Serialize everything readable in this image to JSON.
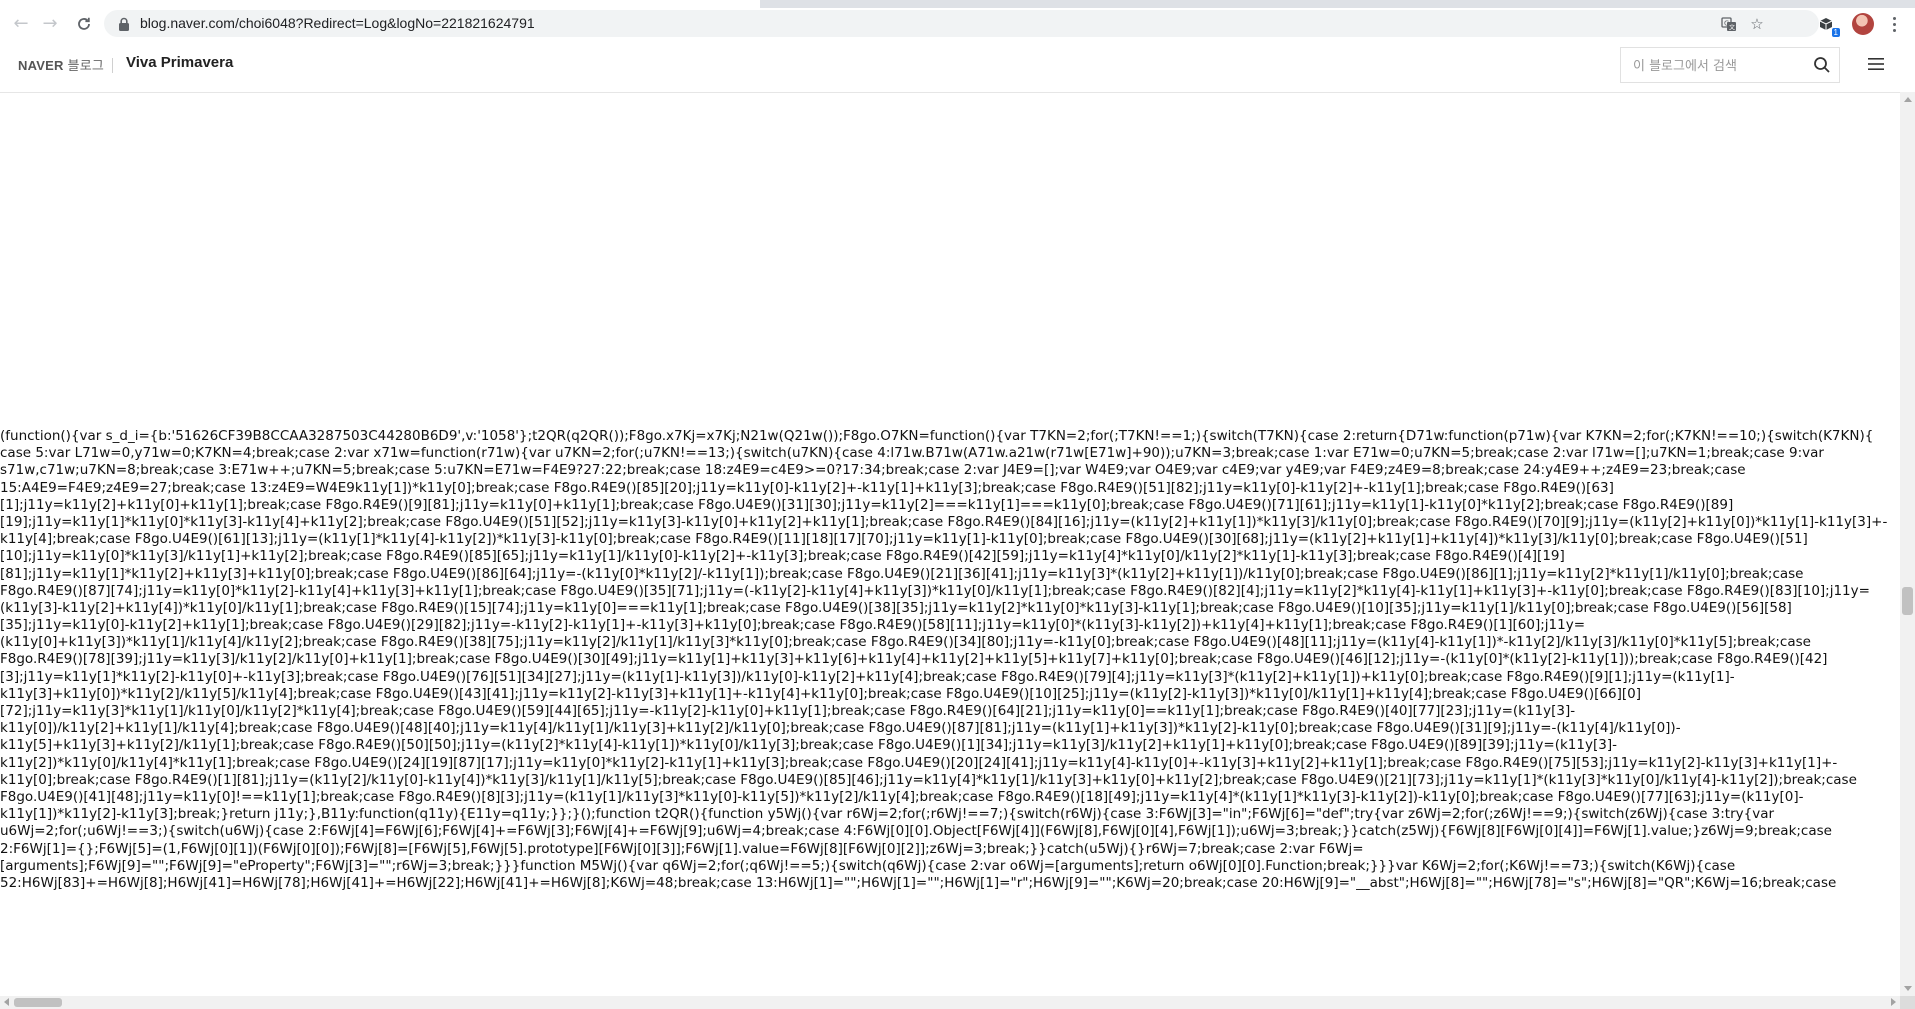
{
  "browser": {
    "url": "blog.naver.com/choi6048?Redirect=Log&logNo=221821624791",
    "extension_badge": "1",
    "icons": {
      "back": "back-arrow-icon",
      "forward": "forward-arrow-icon",
      "reload": "reload-icon",
      "lock": "lock-icon",
      "translate": "translate-icon",
      "bookmark": "star-icon",
      "extension": "extension-icon",
      "menu": "more-vert-icon"
    }
  },
  "header": {
    "naver": "NAVER",
    "blog_word": "블로그",
    "blog_title": "Viva Primavera",
    "search_placeholder": "이 블로그에서 검색",
    "search_icon": "search-icon",
    "menu_icon": "hamburger-menu-icon"
  },
  "content": {
    "code_lines": [
      "(function(){var s_d_i={b:'51626CF39B8CCAA3287503C44280B6D9',v:'1058'};t2QR(q2QR());F8go.x7Kj=x7Kj;N21w(Q21w());F8go.O7KN=function(){var T7KN=2;for(;T7KN!==1;){switch(T7KN){case 2:return{D71w:function(p71w){var K7KN=2;for(;K7KN!==10;){switch(K7KN){",
      "case 5:var L71w=0,y71w=0;K7KN=4;break;case 2:var x71w=function(r71w){var u7KN=2;for(;u7KN!==13;){switch(u7KN){case 4:l71w.B71w(A71w.a21w(r71w[E71w]+90));u7KN=3;break;case 1:var E71w=0;u7KN=5;break;case 2:var l71w=[];u7KN=1;break;case 9:var",
      "s71w,c71w;u7KN=8;break;case 3:E71w++;u7KN=5;break;case 5:u7KN=E71w=F4E9?27:22;break;case 18:z4E9=c4E9>=0?17:34;break;case 2:var J4E9=[];var W4E9;var O4E9;var c4E9;var y4E9;var F4E9;z4E9=8;break;case 24:y4E9++;z4E9=23;break;case",
      "15:A4E9=F4E9;z4E9=27;break;case 13:z4E9=W4E9k11y[1])*k11y[0];break;case F8go.R4E9()[85][20];j11y=k11y[0]-k11y[2]+-k11y[1]+k11y[3];break;case F8go.R4E9()[51][82];j11y=k11y[0]-k11y[2]+-k11y[1];break;case F8go.R4E9()[63]",
      "[1];j11y=k11y[2]+k11y[0]+k11y[1];break;case F8go.R4E9()[9][81];j11y=k11y[0]+k11y[1];break;case F8go.U4E9()[31][30];j11y=k11y[2]===k11y[1]===k11y[0];break;case F8go.U4E9()[71][61];j11y=k11y[1]-k11y[0]*k11y[2];break;case F8go.R4E9()[89]",
      "[19];j11y=k11y[1]*k11y[0]*k11y[3]-k11y[4]+k11y[2];break;case F8go.U4E9()[51][52];j11y=k11y[3]-k11y[0]+k11y[2]+k11y[1];break;case F8go.R4E9()[84][16];j11y=(k11y[2]+k11y[1])*k11y[3]/k11y[0];break;case F8go.R4E9()[70][9];j11y=(k11y[2]+k11y[0])*k11y[1]-k11y[3]+-",
      "k11y[4];break;case F8go.U4E9()[61][13];j11y=(k11y[1]*k11y[4]-k11y[2])*k11y[3]-k11y[0];break;case F8go.R4E9()[11][18][17][70];j11y=k11y[1]-k11y[0];break;case F8go.U4E9()[30][68];j11y=(k11y[2]+k11y[1]+k11y[4])*k11y[3]/k11y[0];break;case F8go.U4E9()[51]",
      "[10];j11y=k11y[0]*k11y[3]/k11y[1]+k11y[2];break;case F8go.R4E9()[85][65];j11y=k11y[1]/k11y[0]-k11y[2]+-k11y[3];break;case F8go.R4E9()[42][59];j11y=k11y[4]*k11y[0]/k11y[2]*k11y[1]-k11y[3];break;case F8go.R4E9()[4][19]",
      "[81];j11y=k11y[1]*k11y[2]+k11y[3]+k11y[0];break;case F8go.U4E9()[86][64];j11y=-(k11y[0]*k11y[2]/-k11y[1]);break;case F8go.U4E9()[21][36][41];j11y=k11y[3]*(k11y[2]+k11y[1])/k11y[0];break;case F8go.U4E9()[86][1];j11y=k11y[2]*k11y[1]/k11y[0];break;case",
      "F8go.R4E9()[87][74];j11y=k11y[0]*k11y[2]-k11y[4]+k11y[3]+k11y[1];break;case F8go.U4E9()[35][71];j11y=(-k11y[2]-k11y[4]+k11y[3])*k11y[0]/k11y[1];break;case F8go.R4E9()[82][4];j11y=k11y[2]*k11y[4]-k11y[1]+k11y[3]+-k11y[0];break;case F8go.R4E9()[83][10];j11y=",
      "(k11y[3]-k11y[2]+k11y[4])*k11y[0]/k11y[1];break;case F8go.R4E9()[15][74];j11y=k11y[0]===k11y[1];break;case F8go.U4E9()[38][35];j11y=k11y[2]*k11y[0]*k11y[3]-k11y[1];break;case F8go.U4E9()[10][35];j11y=k11y[1]/k11y[0];break;case F8go.U4E9()[56][58]",
      "[35];j11y=k11y[0]-k11y[2]+k11y[1];break;case F8go.U4E9()[29][82];j11y=-k11y[2]-k11y[1]+-k11y[3]+k11y[0];break;case F8go.R4E9()[58][11];j11y=k11y[0]*(k11y[3]-k11y[2])+k11y[4]+k11y[1];break;case F8go.R4E9()[1][60];j11y=",
      "(k11y[0]+k11y[3])*k11y[1]/k11y[4]/k11y[2];break;case F8go.R4E9()[38][75];j11y=k11y[2]/k11y[1]/k11y[3]*k11y[0];break;case F8go.R4E9()[34][80];j11y=-k11y[0];break;case F8go.U4E9()[48][11];j11y=(k11y[4]-k11y[1])*-k11y[2]/k11y[3]/k11y[0]*k11y[5];break;case",
      "F8go.R4E9()[78][39];j11y=k11y[3]/k11y[2]/k11y[0]+k11y[1];break;case F8go.U4E9()[30][49];j11y=k11y[1]+k11y[3]+k11y[6]+k11y[4]+k11y[2]+k11y[5]+k11y[7]+k11y[0];break;case F8go.U4E9()[46][12];j11y=-(k11y[0]*(k11y[2]-k11y[1]));break;case F8go.R4E9()[42]",
      "[3];j11y=k11y[1]*k11y[2]-k11y[0]+-k11y[3];break;case F8go.U4E9()[76][51][34][27];j11y=(k11y[1]-k11y[3])/k11y[0]-k11y[2]+k11y[4];break;case F8go.R4E9()[79][4];j11y=k11y[3]*(k11y[2]+k11y[1])+k11y[0];break;case F8go.R4E9()[9][1];j11y=(k11y[1]-",
      "k11y[3]+k11y[0])*k11y[2]/k11y[5]/k11y[4];break;case F8go.U4E9()[43][41];j11y=k11y[2]-k11y[3]+k11y[1]+-k11y[4]+k11y[0];break;case F8go.U4E9()[10][25];j11y=(k11y[2]-k11y[3])*k11y[0]/k11y[1]+k11y[4];break;case F8go.U4E9()[66][0]",
      "[72];j11y=k11y[3]*k11y[1]/k11y[0]/k11y[2]*k11y[4];break;case F8go.U4E9()[59][44][65];j11y=-k11y[2]-k11y[0]+k11y[1];break;case F8go.R4E9()[64][21];j11y=k11y[0]==k11y[1];break;case F8go.R4E9()[40][77][23];j11y=(k11y[3]-",
      "k11y[0])/k11y[2]+k11y[1]/k11y[4];break;case F8go.U4E9()[48][40];j11y=k11y[4]/k11y[1]/k11y[3]+k11y[2]/k11y[0];break;case F8go.U4E9()[87][81];j11y=(k11y[1]+k11y[3])*k11y[2]-k11y[0];break;case F8go.U4E9()[31][9];j11y=-(k11y[4]/k11y[0])-",
      "k11y[5]+k11y[3]+k11y[2]/k11y[1];break;case F8go.R4E9()[50][50];j11y=(k11y[2]*k11y[4]-k11y[1])*k11y[0]/k11y[3];break;case F8go.U4E9()[1][34];j11y=k11y[3]/k11y[2]+k11y[1]+k11y[0];break;case F8go.U4E9()[89][39];j11y=(k11y[3]-",
      "k11y[2])*k11y[0]/k11y[4]*k11y[1];break;case F8go.U4E9()[24][19][87][17];j11y=k11y[0]*k11y[2]-k11y[1]+k11y[3];break;case F8go.U4E9()[20][24][41];j11y=k11y[4]-k11y[0]+-k11y[3]+k11y[2]+k11y[1];break;case F8go.R4E9()[75][53];j11y=k11y[2]-k11y[3]+k11y[1]+-",
      "k11y[0];break;case F8go.R4E9()[1][81];j11y=(k11y[2]/k11y[0]-k11y[4])*k11y[3]/k11y[1]/k11y[5];break;case F8go.U4E9()[85][46];j11y=k11y[4]*k11y[1]/k11y[3]+k11y[0]+k11y[2];break;case F8go.U4E9()[21][73];j11y=k11y[1]*(k11y[3]*k11y[0]/k11y[4]-k11y[2]);break;case",
      "F8go.U4E9()[41][48];j11y=k11y[0]!==k11y[1];break;case F8go.R4E9()[8][3];j11y=(k11y[1]/k11y[3]*k11y[0]-k11y[5])*k11y[2]/k11y[4];break;case F8go.R4E9()[18][49];j11y=k11y[4]*(k11y[1]*k11y[3]-k11y[2])-k11y[0];break;case F8go.U4E9()[77][63];j11y=(k11y[0]-",
      "k11y[1])*k11y[2]-k11y[3];break;}return j11y;},B11y:function(q11y){E11y=q11y;}};}();function t2QR(){function y5Wj(){var r6Wj=2;for(;r6Wj!==7;){switch(r6Wj){case 3:F6Wj[3]=\"in\";F6Wj[6]=\"def\";try{var z6Wj=2;for(;z6Wj!==9;){switch(z6Wj){case 3:try{var",
      "u6Wj=2;for(;u6Wj!==3;){switch(u6Wj){case 2:F6Wj[4]=F6Wj[6];F6Wj[4]+=F6Wj[3];F6Wj[4]+=F6Wj[9];u6Wj=4;break;case 4:F6Wj[0][0].Object[F6Wj[4]](F6Wj[8],F6Wj[0][4],F6Wj[1]);u6Wj=3;break;}}catch(z5Wj){F6Wj[8][F6Wj[0][4]]=F6Wj[1].value;}z6Wj=9;break;case",
      "2:F6Wj[1]={};F6Wj[5]=(1,F6Wj[0][1])(F6Wj[0][0]);F6Wj[8]=[F6Wj[5],F6Wj[5].prototype][F6Wj[0][3]];F6Wj[1].value=F6Wj[8][F6Wj[0][2]];z6Wj=3;break;}}catch(u5Wj){}r6Wj=7;break;case 2:var F6Wj=",
      "[arguments];F6Wj[9]=\"\";F6Wj[9]=\"eProperty\";F6Wj[3]=\"\";r6Wj=3;break;}}}function M5Wj(){var q6Wj=2;for(;q6Wj!==5;){switch(q6Wj){case 2:var o6Wj=[arguments];return o6Wj[0][0].Function;break;}}}var K6Wj=2;for(;K6Wj!==73;){switch(K6Wj){case",
      "52:H6Wj[83]+=H6Wj[8];H6Wj[41]=H6Wj[78];H6Wj[41]+=H6Wj[22];H6Wj[41]+=H6Wj[8];K6Wj=48;break;case 13:H6Wj[1]=\"\";H6Wj[1]=\"\";H6Wj[1]=\"r\";H6Wj[9]=\"\";K6Wj=20;break;case 20:H6Wj[9]=\"__abst\";H6Wj[8]=\"\";H6Wj[78]=\"s\";H6Wj[8]=\"QR\";K6Wj=16;break;case"
    ]
  }
}
